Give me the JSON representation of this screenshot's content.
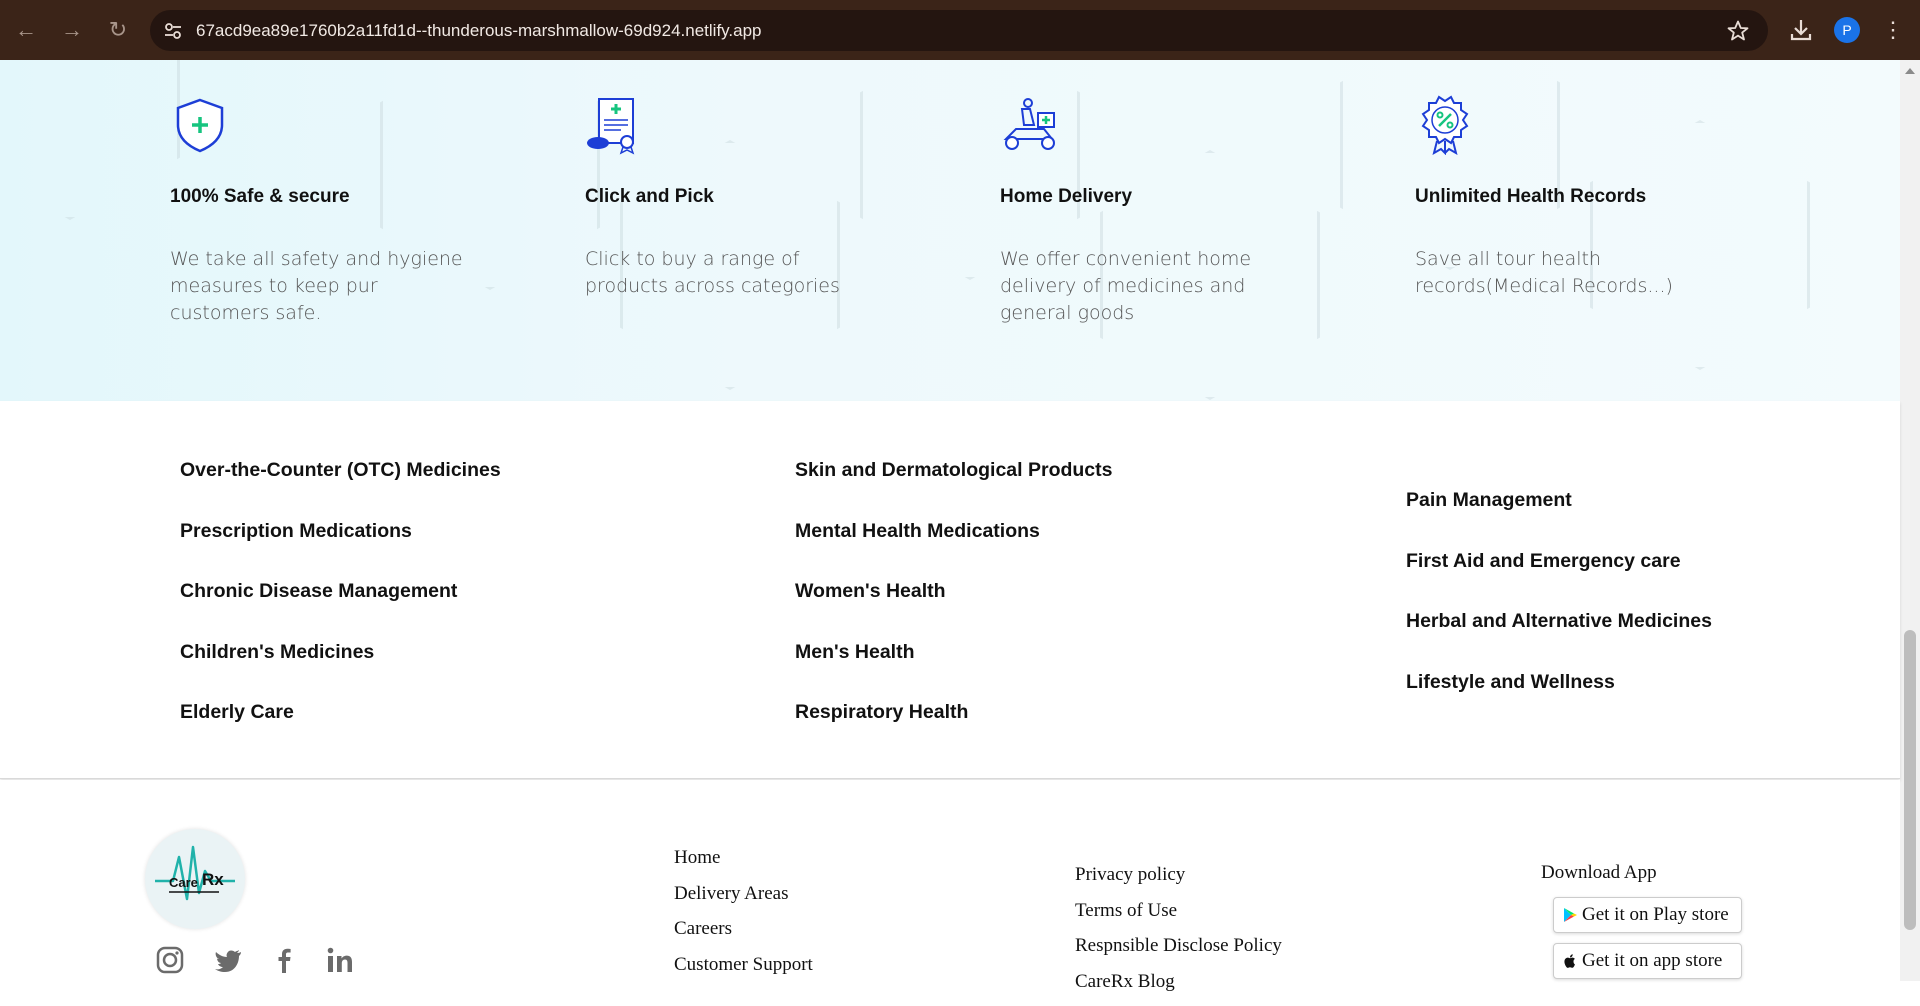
{
  "browser": {
    "url": "67acd9ea89e1760b2a11fd1d--thunderous-marshmallow-69d924.netlify.app",
    "profile_initial": "P"
  },
  "features": [
    {
      "icon": "shield-plus-icon",
      "title": "100% Safe & secure",
      "description": "We take all safety and hygiene measures to keep pur customers safe."
    },
    {
      "icon": "prescription-document-icon",
      "title": "Click and Pick",
      "description": "Click to buy a range of products across categories"
    },
    {
      "icon": "delivery-scooter-icon",
      "title": "Home Delivery",
      "description": "We offer convenient home delivery of medicines and general goods"
    },
    {
      "icon": "discount-badge-icon",
      "title": "Unlimited Health Records",
      "description": "Save all tour health records(Medical Records...)"
    }
  ],
  "categories": {
    "col1": [
      "Over-the-Counter (OTC) Medicines",
      "Prescription Medications",
      "Chronic Disease Management",
      "Children's Medicines",
      "Elderly Care"
    ],
    "col2": [
      "Skin and Dermatological Products",
      "Mental Health Medications",
      "Women's Health",
      "Men's Health",
      "Respiratory Health"
    ],
    "col3": [
      "Pain Management",
      "First Aid and Emergency care",
      "Herbal and Alternative Medicines",
      "Lifestyle and Wellness"
    ]
  },
  "footer": {
    "logo_text_care": "Care",
    "logo_text_rx": "Rx",
    "socials": [
      "instagram-icon",
      "twitter-icon",
      "facebook-icon",
      "linkedin-icon"
    ],
    "links1": [
      "Home",
      "Delivery Areas",
      "Careers",
      "Customer Support"
    ],
    "links2": [
      "Privacy policy",
      "Terms of Use",
      "Respnsible Disclose Policy",
      "CareRx Blog"
    ],
    "download_title": "Download App",
    "play_store": "Get it on Play store",
    "app_store": "Get it on app store"
  },
  "colors": {
    "browser_bar": "#3b2418",
    "accent_green": "#16c47f",
    "icon_blue": "#1d3ed6",
    "logo_teal": "#20b2aa"
  }
}
